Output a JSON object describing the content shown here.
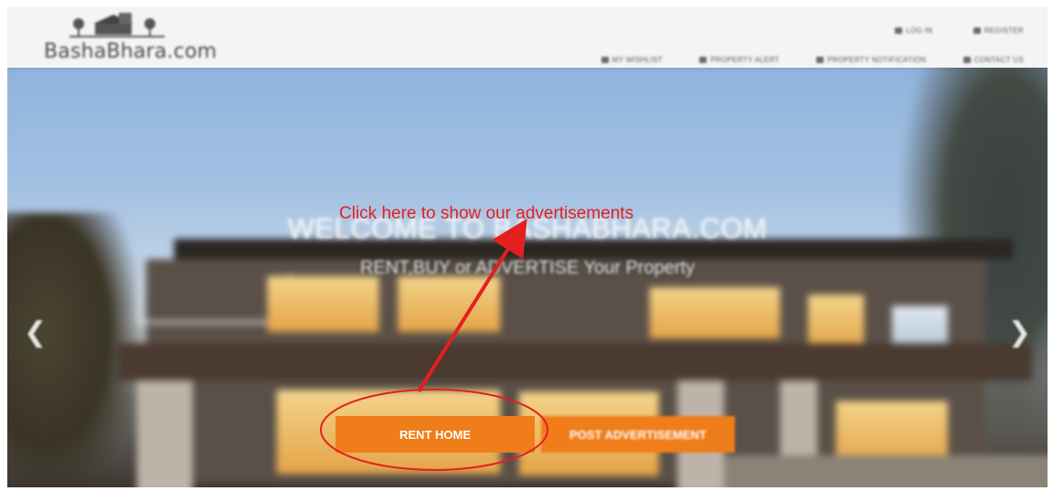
{
  "logo": {
    "text": "BashaBhara.com"
  },
  "top_links": [
    {
      "label": "LOG IN",
      "icon": "login-icon"
    },
    {
      "label": "REGISTER",
      "icon": "user-icon"
    }
  ],
  "nav": [
    {
      "label": "MY WISHLIST",
      "icon": "wishlist-icon"
    },
    {
      "label": "PROPERTY ALERT",
      "icon": "bell-icon"
    },
    {
      "label": "PROPERTY NOTIFICATION",
      "icon": "notification-icon"
    },
    {
      "label": "CONTACT US",
      "icon": "phone-icon"
    }
  ],
  "hero": {
    "title": "WELCOME TO BASHABHARA.COM",
    "subtitle": "RENT,BUY or ADVERTISE Your Property",
    "prev_icon": "chevron-left-icon",
    "next_icon": "chevron-right-icon"
  },
  "buttons": {
    "rent": "RENT HOME",
    "post": "POST ADVERTISEMENT"
  },
  "annotation": {
    "text": "Click here to show our advertisements",
    "color": "#e41f1f"
  },
  "colors": {
    "accent": "#ef7d1a",
    "header_bg": "#f4f4f4"
  }
}
